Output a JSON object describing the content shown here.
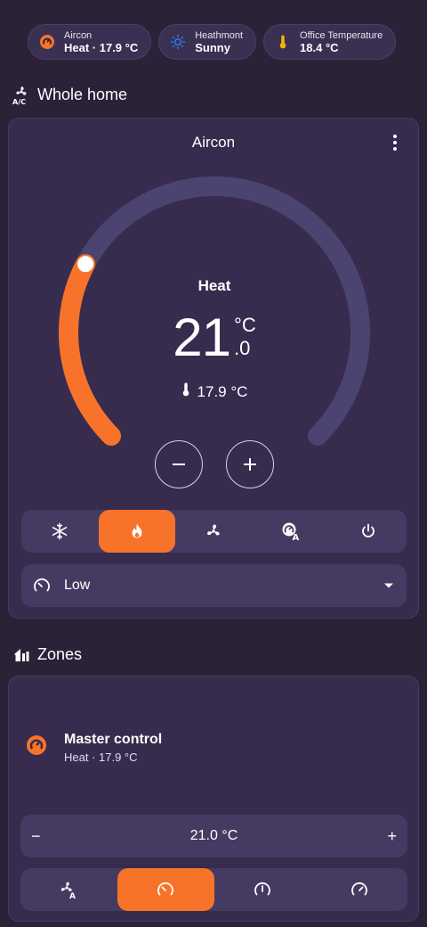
{
  "colors": {
    "accent": "#f8732a",
    "background": "#2b2238",
    "card": "#372c4e",
    "track": "#4b4370",
    "sun": "#2f80ed",
    "thermo": "#f4b400"
  },
  "chips": [
    {
      "icon": "aircon-icon",
      "label": "Aircon",
      "value": "Heat · 17.9 °C"
    },
    {
      "icon": "sun-icon",
      "label": "Heathmont",
      "value": "Sunny"
    },
    {
      "icon": "thermometer-icon",
      "label": "Office Temperature",
      "value": "18.4 °C"
    }
  ],
  "whole_home": {
    "heading": "Whole home",
    "card_title": "Aircon",
    "mode": "Heat",
    "target_int": "21",
    "target_unit": "°C",
    "target_dec": ".0",
    "current_temp": "17.9 °C",
    "dial_fraction": 0.27,
    "hvac_modes": [
      {
        "icon": "snowflake-icon",
        "active": false
      },
      {
        "icon": "fire-icon",
        "active": true
      },
      {
        "icon": "fan-icon",
        "active": false
      },
      {
        "icon": "auto-mode-icon",
        "active": false
      },
      {
        "icon": "power-icon",
        "active": false
      }
    ],
    "fan_speed": "Low"
  },
  "zones": {
    "heading": "Zones",
    "name": "Master control",
    "status": "Heat · 17.9 °C",
    "stepper_value": "21.0 °C",
    "stepper_minus": "−",
    "stepper_plus": "+",
    "fan_modes": [
      {
        "icon": "fan-auto-icon",
        "active": false
      },
      {
        "icon": "speed-low-icon",
        "active": true
      },
      {
        "icon": "speed-medium-icon",
        "active": false
      },
      {
        "icon": "speed-high-icon",
        "active": false
      }
    ]
  }
}
